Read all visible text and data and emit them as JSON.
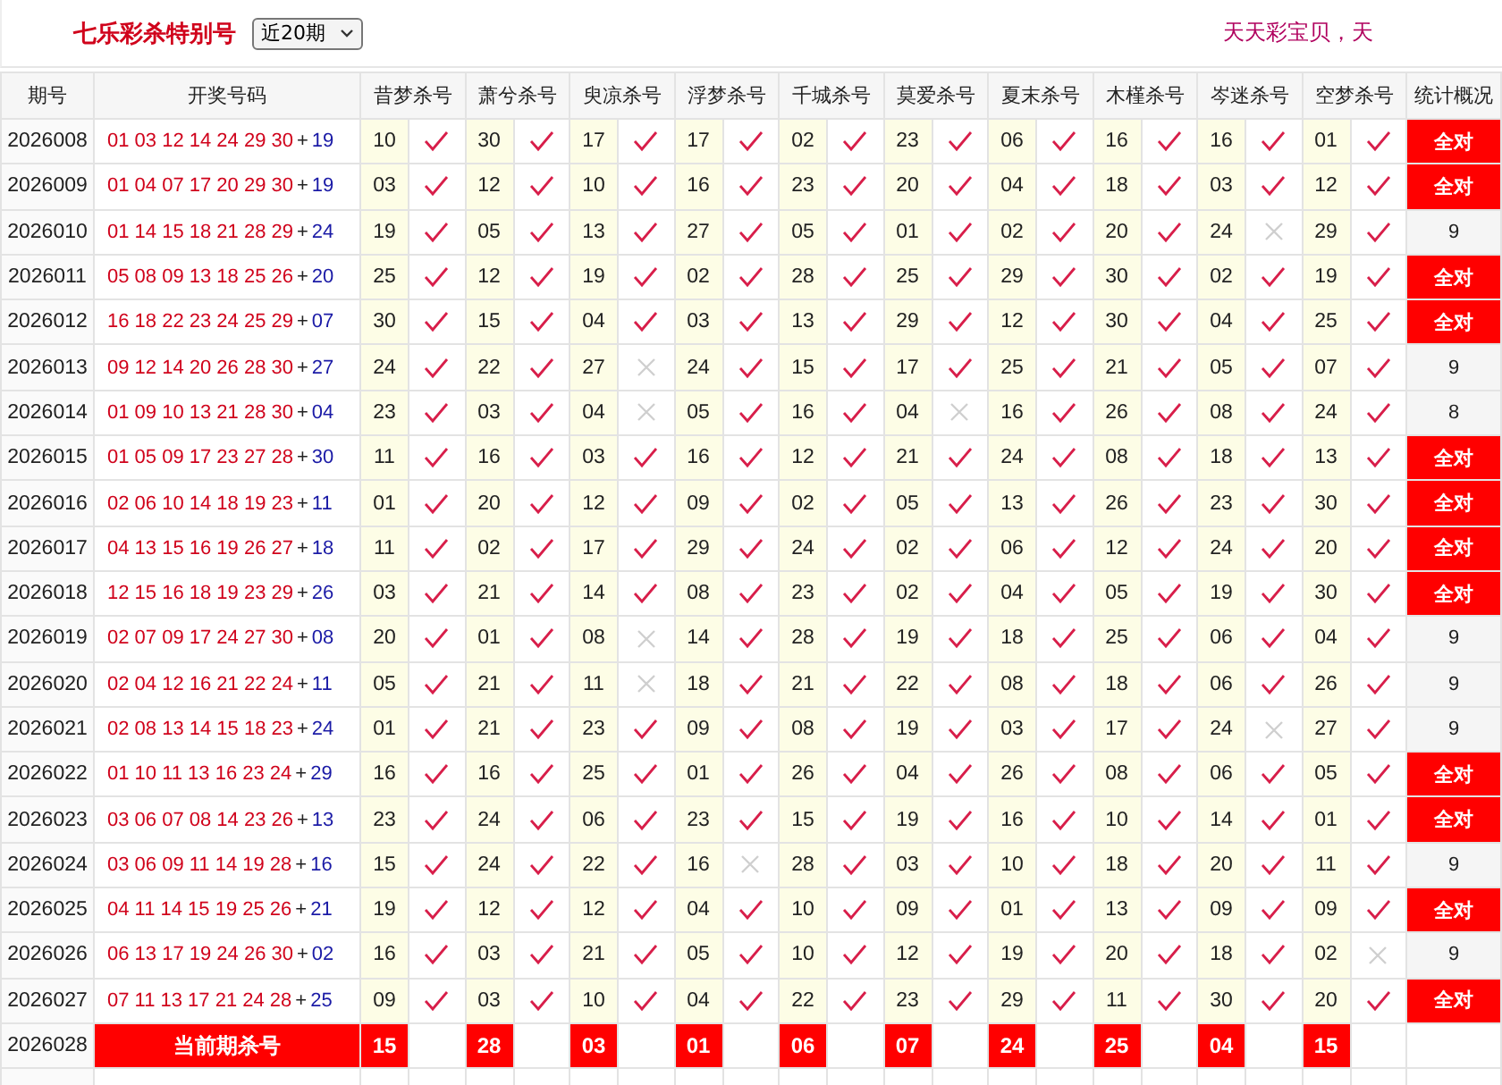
{
  "top_bar": {
    "title": "七乐彩杀特别号",
    "period_select": "近20期",
    "slogan": "天天彩宝贝，天"
  },
  "table": {
    "columns": [
      "期号",
      "开奖号码",
      "昔梦杀号",
      "萧兮杀号",
      "臾凉杀号",
      "浮梦杀号",
      "千城杀号",
      "莫爱杀号",
      "夏末杀号",
      "木槿杀号",
      "岑迷杀号",
      "空梦杀号",
      "统计概况"
    ],
    "rows": [
      {
        "issue": "2026008",
        "reds": "01 03 12 14 24 29 30",
        "plus": "+",
        "blue": "19",
        "kills": [
          {
            "n": "10",
            "hit": true
          },
          {
            "n": "30",
            "hit": true
          },
          {
            "n": "17",
            "hit": true
          },
          {
            "n": "17",
            "hit": true
          },
          {
            "n": "02",
            "hit": true
          },
          {
            "n": "23",
            "hit": true
          },
          {
            "n": "06",
            "hit": true
          },
          {
            "n": "16",
            "hit": true
          },
          {
            "n": "16",
            "hit": true
          },
          {
            "n": "01",
            "hit": true
          }
        ],
        "summary": "全对",
        "perfect": true
      },
      {
        "issue": "2026009",
        "reds": "01 04 07 17 20 29 30",
        "plus": "+",
        "blue": "19",
        "kills": [
          {
            "n": "03",
            "hit": true
          },
          {
            "n": "12",
            "hit": true
          },
          {
            "n": "10",
            "hit": true
          },
          {
            "n": "16",
            "hit": true
          },
          {
            "n": "23",
            "hit": true
          },
          {
            "n": "20",
            "hit": true
          },
          {
            "n": "04",
            "hit": true
          },
          {
            "n": "18",
            "hit": true
          },
          {
            "n": "03",
            "hit": true
          },
          {
            "n": "12",
            "hit": true
          }
        ],
        "summary": "全对",
        "perfect": true
      },
      {
        "issue": "2026010",
        "reds": "01 14 15 18 21 28 29",
        "plus": "+",
        "blue": "24",
        "kills": [
          {
            "n": "19",
            "hit": true
          },
          {
            "n": "05",
            "hit": true
          },
          {
            "n": "13",
            "hit": true
          },
          {
            "n": "27",
            "hit": true
          },
          {
            "n": "05",
            "hit": true
          },
          {
            "n": "01",
            "hit": true
          },
          {
            "n": "02",
            "hit": true
          },
          {
            "n": "20",
            "hit": true
          },
          {
            "n": "24",
            "hit": false
          },
          {
            "n": "29",
            "hit": true
          }
        ],
        "summary": "9",
        "perfect": false
      },
      {
        "issue": "2026011",
        "reds": "05 08 09 13 18 25 26",
        "plus": "+",
        "blue": "20",
        "kills": [
          {
            "n": "25",
            "hit": true
          },
          {
            "n": "12",
            "hit": true
          },
          {
            "n": "19",
            "hit": true
          },
          {
            "n": "02",
            "hit": true
          },
          {
            "n": "28",
            "hit": true
          },
          {
            "n": "25",
            "hit": true
          },
          {
            "n": "29",
            "hit": true
          },
          {
            "n": "30",
            "hit": true
          },
          {
            "n": "02",
            "hit": true
          },
          {
            "n": "19",
            "hit": true
          }
        ],
        "summary": "全对",
        "perfect": true
      },
      {
        "issue": "2026012",
        "reds": "16 18 22 23 24 25 29",
        "plus": "+",
        "blue": "07",
        "kills": [
          {
            "n": "30",
            "hit": true
          },
          {
            "n": "15",
            "hit": true
          },
          {
            "n": "04",
            "hit": true
          },
          {
            "n": "03",
            "hit": true
          },
          {
            "n": "13",
            "hit": true
          },
          {
            "n": "29",
            "hit": true
          },
          {
            "n": "12",
            "hit": true
          },
          {
            "n": "30",
            "hit": true
          },
          {
            "n": "04",
            "hit": true
          },
          {
            "n": "25",
            "hit": true
          }
        ],
        "summary": "全对",
        "perfect": true
      },
      {
        "issue": "2026013",
        "reds": "09 12 14 20 26 28 30",
        "plus": "+",
        "blue": "27",
        "kills": [
          {
            "n": "24",
            "hit": true
          },
          {
            "n": "22",
            "hit": true
          },
          {
            "n": "27",
            "hit": false
          },
          {
            "n": "24",
            "hit": true
          },
          {
            "n": "15",
            "hit": true
          },
          {
            "n": "17",
            "hit": true
          },
          {
            "n": "25",
            "hit": true
          },
          {
            "n": "21",
            "hit": true
          },
          {
            "n": "05",
            "hit": true
          },
          {
            "n": "07",
            "hit": true
          }
        ],
        "summary": "9",
        "perfect": false
      },
      {
        "issue": "2026014",
        "reds": "01 09 10 13 21 28 30",
        "plus": "+",
        "blue": "04",
        "kills": [
          {
            "n": "23",
            "hit": true
          },
          {
            "n": "03",
            "hit": true
          },
          {
            "n": "04",
            "hit": false
          },
          {
            "n": "05",
            "hit": true
          },
          {
            "n": "16",
            "hit": true
          },
          {
            "n": "04",
            "hit": false
          },
          {
            "n": "16",
            "hit": true
          },
          {
            "n": "26",
            "hit": true
          },
          {
            "n": "08",
            "hit": true
          },
          {
            "n": "24",
            "hit": true
          }
        ],
        "summary": "8",
        "perfect": false
      },
      {
        "issue": "2026015",
        "reds": "01 05 09 17 23 27 28",
        "plus": "+",
        "blue": "30",
        "kills": [
          {
            "n": "11",
            "hit": true
          },
          {
            "n": "16",
            "hit": true
          },
          {
            "n": "03",
            "hit": true
          },
          {
            "n": "16",
            "hit": true
          },
          {
            "n": "12",
            "hit": true
          },
          {
            "n": "21",
            "hit": true
          },
          {
            "n": "24",
            "hit": true
          },
          {
            "n": "08",
            "hit": true
          },
          {
            "n": "18",
            "hit": true
          },
          {
            "n": "13",
            "hit": true
          }
        ],
        "summary": "全对",
        "perfect": true
      },
      {
        "issue": "2026016",
        "reds": "02 06 10 14 18 19 23",
        "plus": "+",
        "blue": "11",
        "kills": [
          {
            "n": "01",
            "hit": true
          },
          {
            "n": "20",
            "hit": true
          },
          {
            "n": "12",
            "hit": true
          },
          {
            "n": "09",
            "hit": true
          },
          {
            "n": "02",
            "hit": true
          },
          {
            "n": "05",
            "hit": true
          },
          {
            "n": "13",
            "hit": true
          },
          {
            "n": "26",
            "hit": true
          },
          {
            "n": "23",
            "hit": true
          },
          {
            "n": "30",
            "hit": true
          }
        ],
        "summary": "全对",
        "perfect": true
      },
      {
        "issue": "2026017",
        "reds": "04 13 15 16 19 26 27",
        "plus": "+",
        "blue": "18",
        "kills": [
          {
            "n": "11",
            "hit": true
          },
          {
            "n": "02",
            "hit": true
          },
          {
            "n": "17",
            "hit": true
          },
          {
            "n": "29",
            "hit": true
          },
          {
            "n": "24",
            "hit": true
          },
          {
            "n": "02",
            "hit": true
          },
          {
            "n": "06",
            "hit": true
          },
          {
            "n": "12",
            "hit": true
          },
          {
            "n": "24",
            "hit": true
          },
          {
            "n": "20",
            "hit": true
          }
        ],
        "summary": "全对",
        "perfect": true
      },
      {
        "issue": "2026018",
        "reds": "12 15 16 18 19 23 29",
        "plus": "+",
        "blue": "26",
        "kills": [
          {
            "n": "03",
            "hit": true
          },
          {
            "n": "21",
            "hit": true
          },
          {
            "n": "14",
            "hit": true
          },
          {
            "n": "08",
            "hit": true
          },
          {
            "n": "23",
            "hit": true
          },
          {
            "n": "02",
            "hit": true
          },
          {
            "n": "04",
            "hit": true
          },
          {
            "n": "05",
            "hit": true
          },
          {
            "n": "19",
            "hit": true
          },
          {
            "n": "30",
            "hit": true
          }
        ],
        "summary": "全对",
        "perfect": true
      },
      {
        "issue": "2026019",
        "reds": "02 07 09 17 24 27 30",
        "plus": "+",
        "blue": "08",
        "kills": [
          {
            "n": "20",
            "hit": true
          },
          {
            "n": "01",
            "hit": true
          },
          {
            "n": "08",
            "hit": false
          },
          {
            "n": "14",
            "hit": true
          },
          {
            "n": "28",
            "hit": true
          },
          {
            "n": "19",
            "hit": true
          },
          {
            "n": "18",
            "hit": true
          },
          {
            "n": "25",
            "hit": true
          },
          {
            "n": "06",
            "hit": true
          },
          {
            "n": "04",
            "hit": true
          }
        ],
        "summary": "9",
        "perfect": false
      },
      {
        "issue": "2026020",
        "reds": "02 04 12 16 21 22 24",
        "plus": "+",
        "blue": "11",
        "kills": [
          {
            "n": "05",
            "hit": true
          },
          {
            "n": "21",
            "hit": true
          },
          {
            "n": "11",
            "hit": false
          },
          {
            "n": "18",
            "hit": true
          },
          {
            "n": "21",
            "hit": true
          },
          {
            "n": "22",
            "hit": true
          },
          {
            "n": "08",
            "hit": true
          },
          {
            "n": "18",
            "hit": true
          },
          {
            "n": "06",
            "hit": true
          },
          {
            "n": "26",
            "hit": true
          }
        ],
        "summary": "9",
        "perfect": false
      },
      {
        "issue": "2026021",
        "reds": "02 08 13 14 15 18 23",
        "plus": "+",
        "blue": "24",
        "kills": [
          {
            "n": "01",
            "hit": true
          },
          {
            "n": "21",
            "hit": true
          },
          {
            "n": "23",
            "hit": true
          },
          {
            "n": "09",
            "hit": true
          },
          {
            "n": "08",
            "hit": true
          },
          {
            "n": "19",
            "hit": true
          },
          {
            "n": "03",
            "hit": true
          },
          {
            "n": "17",
            "hit": true
          },
          {
            "n": "24",
            "hit": false
          },
          {
            "n": "27",
            "hit": true
          }
        ],
        "summary": "9",
        "perfect": false
      },
      {
        "issue": "2026022",
        "reds": "01 10 11 13 16 23 24",
        "plus": "+",
        "blue": "29",
        "kills": [
          {
            "n": "16",
            "hit": true
          },
          {
            "n": "16",
            "hit": true
          },
          {
            "n": "25",
            "hit": true
          },
          {
            "n": "01",
            "hit": true
          },
          {
            "n": "26",
            "hit": true
          },
          {
            "n": "04",
            "hit": true
          },
          {
            "n": "26",
            "hit": true
          },
          {
            "n": "08",
            "hit": true
          },
          {
            "n": "06",
            "hit": true
          },
          {
            "n": "05",
            "hit": true
          }
        ],
        "summary": "全对",
        "perfect": true
      },
      {
        "issue": "2026023",
        "reds": "03 06 07 08 14 23 26",
        "plus": "+",
        "blue": "13",
        "kills": [
          {
            "n": "23",
            "hit": true
          },
          {
            "n": "24",
            "hit": true
          },
          {
            "n": "06",
            "hit": true
          },
          {
            "n": "23",
            "hit": true
          },
          {
            "n": "15",
            "hit": true
          },
          {
            "n": "19",
            "hit": true
          },
          {
            "n": "16",
            "hit": true
          },
          {
            "n": "10",
            "hit": true
          },
          {
            "n": "14",
            "hit": true
          },
          {
            "n": "01",
            "hit": true
          }
        ],
        "summary": "全对",
        "perfect": true
      },
      {
        "issue": "2026024",
        "reds": "03 06 09 11 14 19 28",
        "plus": "+",
        "blue": "16",
        "kills": [
          {
            "n": "15",
            "hit": true
          },
          {
            "n": "24",
            "hit": true
          },
          {
            "n": "22",
            "hit": true
          },
          {
            "n": "16",
            "hit": false
          },
          {
            "n": "28",
            "hit": true
          },
          {
            "n": "03",
            "hit": true
          },
          {
            "n": "10",
            "hit": true
          },
          {
            "n": "18",
            "hit": true
          },
          {
            "n": "20",
            "hit": true
          },
          {
            "n": "11",
            "hit": true
          }
        ],
        "summary": "9",
        "perfect": false
      },
      {
        "issue": "2026025",
        "reds": "04 11 14 15 19 25 26",
        "plus": "+",
        "blue": "21",
        "kills": [
          {
            "n": "19",
            "hit": true
          },
          {
            "n": "12",
            "hit": true
          },
          {
            "n": "12",
            "hit": true
          },
          {
            "n": "04",
            "hit": true
          },
          {
            "n": "10",
            "hit": true
          },
          {
            "n": "09",
            "hit": true
          },
          {
            "n": "01",
            "hit": true
          },
          {
            "n": "13",
            "hit": true
          },
          {
            "n": "09",
            "hit": true
          },
          {
            "n": "09",
            "hit": true
          }
        ],
        "summary": "全对",
        "perfect": true
      },
      {
        "issue": "2026026",
        "reds": "06 13 17 19 24 26 30",
        "plus": "+",
        "blue": "02",
        "kills": [
          {
            "n": "16",
            "hit": true
          },
          {
            "n": "03",
            "hit": true
          },
          {
            "n": "21",
            "hit": true
          },
          {
            "n": "05",
            "hit": true
          },
          {
            "n": "10",
            "hit": true
          },
          {
            "n": "12",
            "hit": true
          },
          {
            "n": "19",
            "hit": true
          },
          {
            "n": "20",
            "hit": true
          },
          {
            "n": "18",
            "hit": true
          },
          {
            "n": "02",
            "hit": false
          }
        ],
        "summary": "9",
        "perfect": false
      },
      {
        "issue": "2026027",
        "reds": "07 11 13 17 21 24 28",
        "plus": "+",
        "blue": "25",
        "kills": [
          {
            "n": "09",
            "hit": true
          },
          {
            "n": "03",
            "hit": true
          },
          {
            "n": "10",
            "hit": true
          },
          {
            "n": "04",
            "hit": true
          },
          {
            "n": "22",
            "hit": true
          },
          {
            "n": "23",
            "hit": true
          },
          {
            "n": "29",
            "hit": true
          },
          {
            "n": "11",
            "hit": true
          },
          {
            "n": "30",
            "hit": true
          },
          {
            "n": "20",
            "hit": true
          }
        ],
        "summary": "全对",
        "perfect": true
      }
    ],
    "current": {
      "issue": "2026028",
      "label": "当前期杀号",
      "kills": [
        "15",
        "28",
        "03",
        "01",
        "06",
        "07",
        "24",
        "25",
        "04",
        "15"
      ]
    }
  }
}
